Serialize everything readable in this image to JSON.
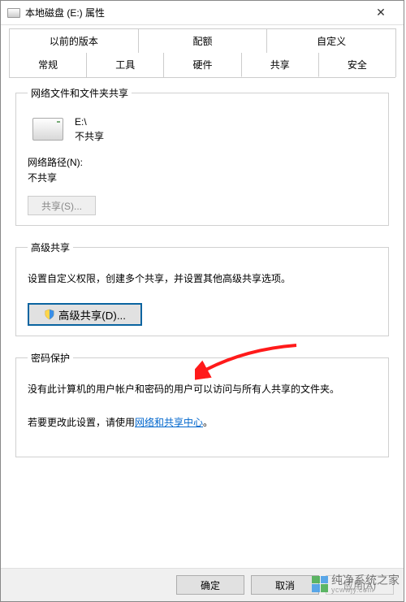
{
  "window": {
    "title": "本地磁盘 (E:) 属性"
  },
  "tabs_row1": [
    {
      "label": "以前的版本"
    },
    {
      "label": "配额"
    },
    {
      "label": "自定义"
    }
  ],
  "tabs_row2": [
    {
      "label": "常规"
    },
    {
      "label": "工具"
    },
    {
      "label": "硬件"
    },
    {
      "label": "共享",
      "active": true
    },
    {
      "label": "安全"
    }
  ],
  "group_share": {
    "legend": "网络文件和文件夹共享",
    "drive_path": "E:\\",
    "share_status": "不共享",
    "network_path_label": "网络路径(N):",
    "network_path_value": "不共享",
    "share_button": "共享(S)..."
  },
  "group_adv": {
    "legend": "高级共享",
    "desc": "设置自定义权限，创建多个共享，并设置其他高级共享选项。",
    "button": "高级共享(D)..."
  },
  "group_pwd": {
    "legend": "密码保护",
    "desc1": "没有此计算机的用户帐户和密码的用户可以访问与所有人共享的文件夹。",
    "desc2_prefix": "若要更改此设置，请使用",
    "desc2_link": "网络和共享中心",
    "desc2_suffix": "。"
  },
  "footer": {
    "ok": "确定",
    "cancel": "取消",
    "apply": "应用(A)"
  },
  "watermark": {
    "name": "纯净系统之家",
    "url": "ycwwjy.com"
  }
}
